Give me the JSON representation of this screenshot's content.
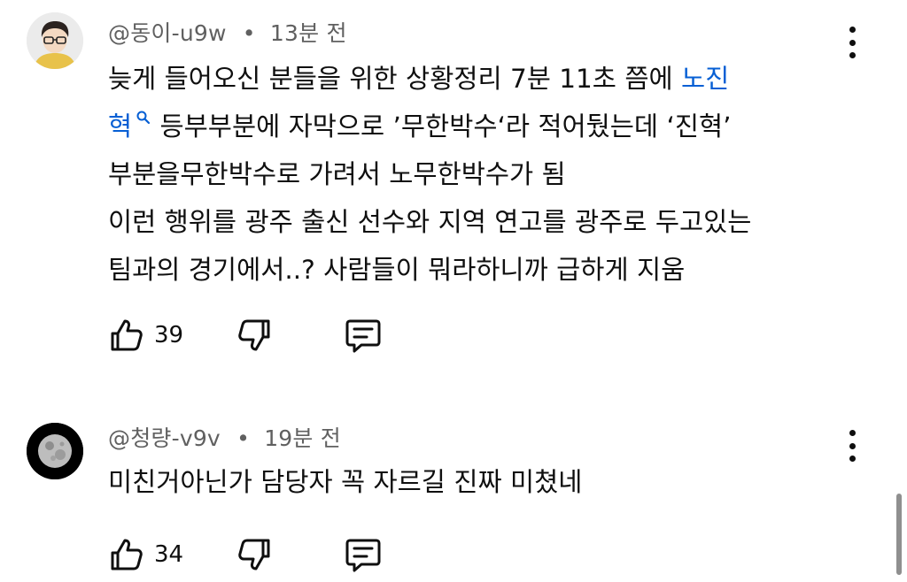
{
  "comments": [
    {
      "handle": "@동이-u9w",
      "separator": "•",
      "time": "13분 전",
      "body": {
        "line1_text": "늦게 들어오신 분들을 위한 상황정리 7분 11초 쯤에 ",
        "mention_part1": "노진",
        "mention_part2": "혁",
        "line2_text": " 등부부분에 자막으로 ’무한박수‘라 적어뒀는데 ‘진혁’",
        "line3": "부분을무한박수로 가려서 노무한박수가 됨",
        "line4": "이런 행위를 광주 출신 선수와 지역 연고를 광주로 두고있는",
        "line5": "팀과의 경기에서..? 사람들이 뭐라하니까 급하게 지움"
      },
      "like_count": "39",
      "icons": {
        "avatar": "avatar-boy-with-glasses",
        "more": "more-vert-icon",
        "mention": "search-icon",
        "like": "thumbs-up-icon",
        "dislike": "thumbs-down-icon",
        "reply": "reply-comment-icon"
      }
    },
    {
      "handle": "@청량-v9v",
      "separator": "•",
      "time": "19분 전",
      "body": {
        "line1": "미친거아닌가 담당자 꼭 자르길 진짜 미쳤네"
      },
      "like_count": "34",
      "icons": {
        "avatar": "avatar-moon",
        "more": "more-vert-icon",
        "like": "thumbs-up-icon",
        "dislike": "thumbs-down-icon",
        "reply": "reply-comment-icon"
      }
    }
  ],
  "colors": {
    "text": "#0f0f0f",
    "meta": "#606060",
    "mention": "#065fd4",
    "background": "#ffffff"
  }
}
